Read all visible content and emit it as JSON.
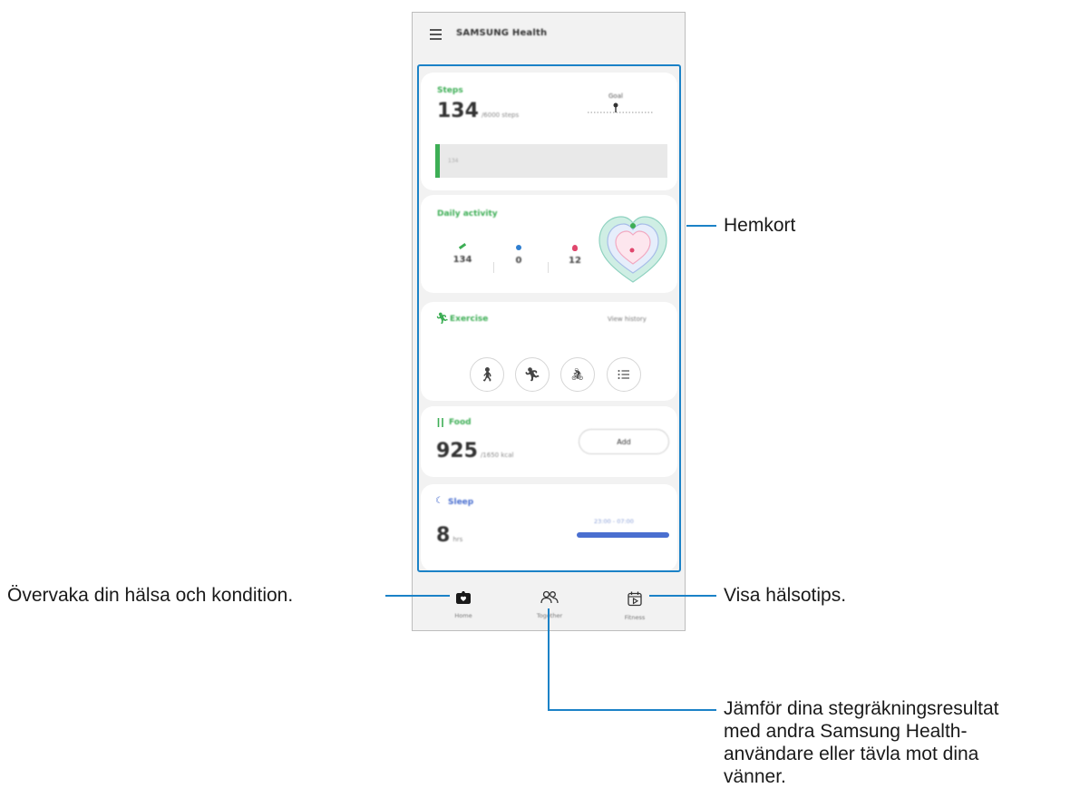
{
  "app": {
    "title": "SAMSUNG Health"
  },
  "cards": {
    "steps": {
      "label": "Steps",
      "value": "134",
      "unit": "/6000 steps",
      "goal_label": "Goal",
      "bar_text": "134"
    },
    "daily_activity": {
      "label": "Daily activity",
      "stats": [
        "134",
        "0",
        "12"
      ]
    },
    "exercise": {
      "label": "Exercise",
      "link": "View history"
    },
    "food": {
      "label": "Food",
      "value": "925",
      "unit": "/1650 kcal",
      "button": "Add"
    },
    "sleep": {
      "label": "Sleep",
      "value": "8",
      "unit": "hrs",
      "time": "23:00 - 07:00"
    }
  },
  "nav": [
    {
      "label": "Home",
      "icon": "home-icon"
    },
    {
      "label": "Together",
      "icon": "together-icon"
    },
    {
      "label": "Fitness",
      "icon": "fitness-icon"
    }
  ],
  "callouts": {
    "home_cards": "Hemkort",
    "monitor": "Övervaka din hälsa och kondition.",
    "tips": "Visa hälsotips.",
    "compare": [
      "Jämför dina stegräkningsresultat",
      "med andra Samsung Health-",
      "användare eller tävla mot dina",
      "vänner."
    ]
  },
  "colors": {
    "accent_green": "#3dae55",
    "accent_blue": "#4a6fd0",
    "callout_line": "#1b82c7"
  }
}
